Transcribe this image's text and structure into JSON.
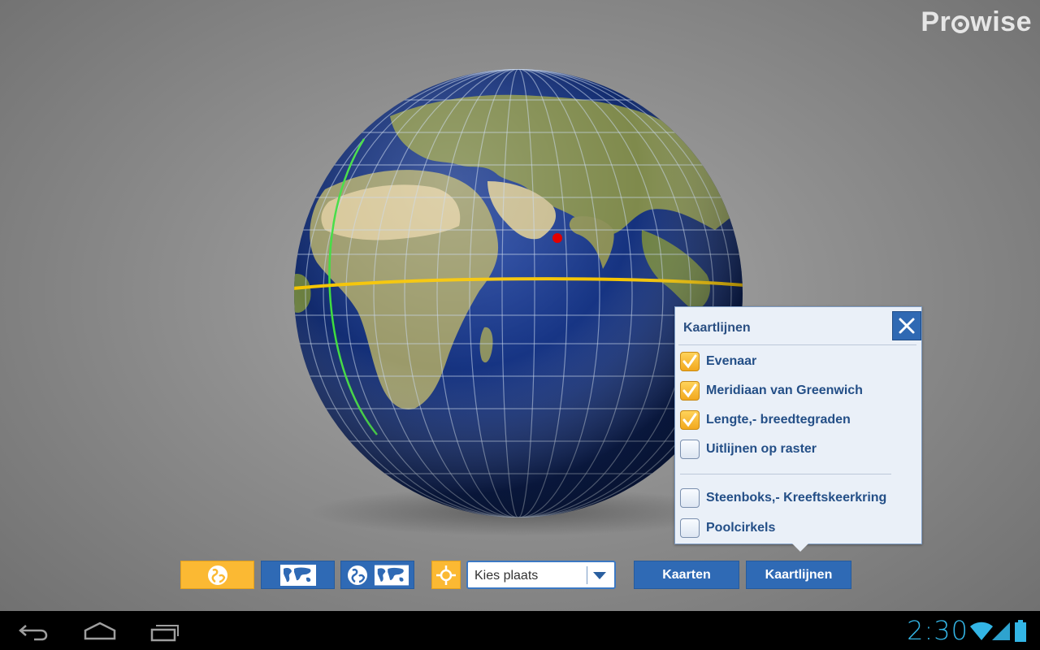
{
  "branding": {
    "logo_text_left": "Pr",
    "logo_text_right": "wise"
  },
  "popup": {
    "title": "Kaartlijnen",
    "options": [
      {
        "label": "Evenaar",
        "checked": true
      },
      {
        "label": "Meridiaan van Greenwich",
        "checked": true
      },
      {
        "label": "Lengte,- breedtegraden",
        "checked": true
      },
      {
        "label": "Uitlijnen op raster",
        "checked": false
      },
      {
        "label": "Steenboks,- Kreeftskeerkring",
        "checked": false
      },
      {
        "label": "Poolcirkels",
        "checked": false
      }
    ]
  },
  "toolbar": {
    "globe_view_icon": "globe-icon",
    "map_view_icon": "world-map-icon",
    "globe_map_view_icon": "globe-and-map-icon",
    "locate_icon": "crosshair-icon",
    "place_select": {
      "value": "Kies plaats"
    },
    "maps_label": "Kaarten",
    "map_lines_label": "Kaartlijnen"
  },
  "colors": {
    "toolbar_blue": "#2f6ab5",
    "toolbar_active_yellow": "#fbb933",
    "equator": "#f5c400",
    "greenwich": "#3ddc3d",
    "marker": "#e30000",
    "clock": "#33b5e5"
  },
  "system_bar": {
    "clock": "2:30",
    "nav_icons": [
      "back-icon",
      "home-icon",
      "recent-apps-icon"
    ],
    "status_icons": [
      "wifi-icon",
      "signal-icon",
      "battery-icon"
    ]
  }
}
